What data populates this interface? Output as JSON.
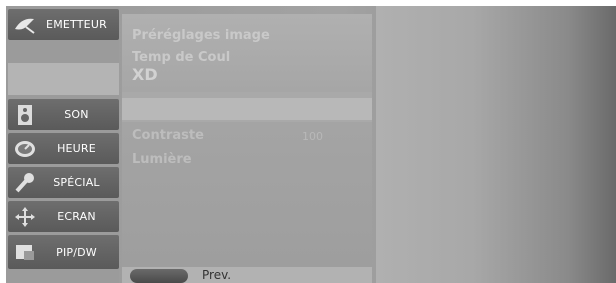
{
  "sidebar": {
    "items": [
      {
        "label": "EMETTEUR",
        "icon": "satellite-dish-icon"
      },
      {
        "label": "SON",
        "icon": "speaker-icon"
      },
      {
        "label": "HEURE",
        "icon": "clock-icon"
      },
      {
        "label": "SPÉCIAL",
        "icon": "key-icon"
      },
      {
        "label": "ECRAN",
        "icon": "move-arrows-icon"
      },
      {
        "label": "PIP/DW",
        "icon": "pip-icon"
      }
    ]
  },
  "panel": {
    "top_options": [
      "Préréglages image",
      "Temp de Coul"
    ],
    "xd_label": "XD",
    "bottom_options": [
      {
        "label": "Contraste",
        "value": "100"
      },
      {
        "label": "Lumière",
        "value": ""
      }
    ]
  },
  "footer": {
    "prev_label": "Prev."
  }
}
